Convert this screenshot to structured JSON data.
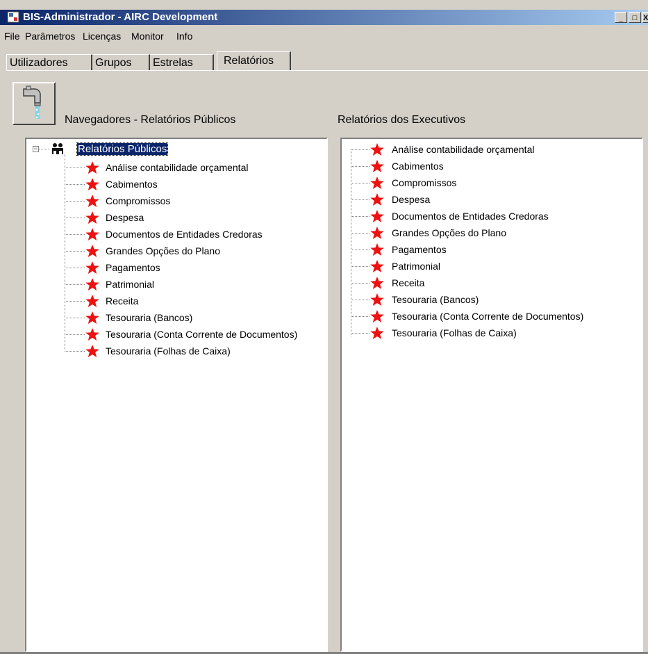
{
  "window": {
    "title": "BIS-Administrador - AIRC Development",
    "minimize_label": "_",
    "maximize_label": "□",
    "close_label": "X"
  },
  "menu": [
    "File",
    "Parâmetros",
    "Licenças",
    "Monitor",
    "Info"
  ],
  "tabs": [
    {
      "label": "Utilizadores",
      "active": false
    },
    {
      "label": "Grupos",
      "active": false
    },
    {
      "label": "Estrelas",
      "active": false
    },
    {
      "label": "Relatórios",
      "active": true
    }
  ],
  "left_panel": {
    "label": "Navegadores - Relatórios Públicos",
    "root": {
      "label": "Relatórios Públicos",
      "icon": "group-icon",
      "expander": "−"
    },
    "items": [
      "Análise contabilidade orçamental",
      "Cabimentos",
      "Compromissos",
      "Despesa",
      "Documentos de Entidades Credoras",
      "Grandes Opções do Plano",
      "Pagamentos",
      "Patrimonial",
      "Receita",
      "Tesouraria (Bancos)",
      "Tesouraria (Conta Corrente de Documentos)",
      "Tesouraria (Folhas de Caixa)"
    ]
  },
  "right_panel": {
    "label": "Relatórios dos Executivos",
    "items": [
      "Análise contabilidade orçamental",
      "Cabimentos",
      "Compromissos",
      "Despesa",
      "Documentos de Entidades Credoras",
      "Grandes Opções do Plano",
      "Pagamentos",
      "Patrimonial",
      "Receita",
      "Tesouraria (Bancos)",
      "Tesouraria (Conta Corrente de Documentos)",
      "Tesouraria (Folhas de Caixa)"
    ]
  },
  "colors": {
    "star": "#ee1111",
    "selection": "#0a246a",
    "face": "#d4d0c8"
  }
}
